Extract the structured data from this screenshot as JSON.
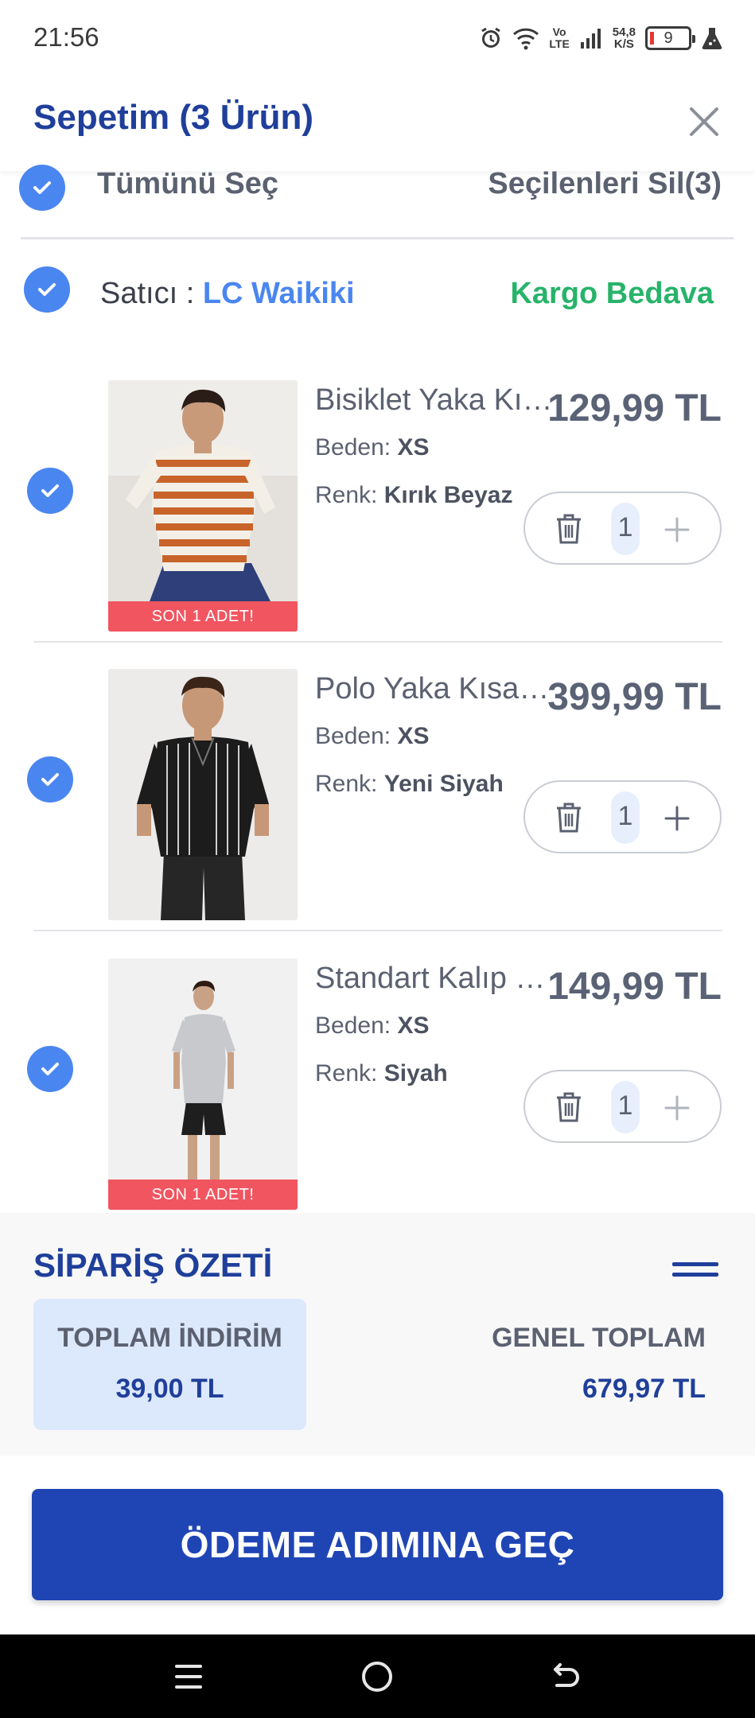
{
  "status_bar": {
    "time": "21:56",
    "network_top": "Vo",
    "network_bottom": "LTE",
    "speed_value": "54,8",
    "speed_unit": "K/S",
    "battery": "9"
  },
  "header": {
    "title": "Sepetim (3 Ürün)"
  },
  "selection": {
    "select_all_label": "Tümünü Seç",
    "delete_selected_label": "Seçilenleri Sil(3)"
  },
  "seller": {
    "label": "Satıcı : ",
    "name": "LC Waikiki",
    "shipping": "Kargo Bedava"
  },
  "product_labels": {
    "size": "Beden:",
    "color": "Renk:"
  },
  "products": [
    {
      "name": "Bisiklet Yaka Kısa Kollu Çizgili Erkek Tişört",
      "price": "129,99 TL",
      "size": "XS",
      "color": "Kırık Beyaz",
      "quantity": "1",
      "badge": "SON 1 ADET!"
    },
    {
      "name": "Polo Yaka Kısa Kollu Çizgili Erkek Tişört",
      "price": "399,99 TL",
      "size": "XS",
      "color": "Yeni Siyah",
      "quantity": "1",
      "badge": ""
    },
    {
      "name": "Standart Kalıp Erkek Pijama Takımı",
      "price": "149,99 TL",
      "size": "XS",
      "color": "Siyah",
      "quantity": "1",
      "badge": "SON 1 ADET!"
    }
  ],
  "summary": {
    "title": "SİPARİŞ ÖZETİ",
    "discount_label": "TOPLAM İNDİRİM",
    "discount_value": "39,00 TL",
    "total_label": "GENEL TOPLAM",
    "total_value": "679,97 TL"
  },
  "checkout": {
    "button_label": "ÖDEME ADIMINA GEÇ"
  },
  "colors": {
    "brand_blue": "#1f45b5",
    "check_blue": "#4a86f0",
    "shipping_green": "#27b36a",
    "badge_red": "#f05560"
  }
}
